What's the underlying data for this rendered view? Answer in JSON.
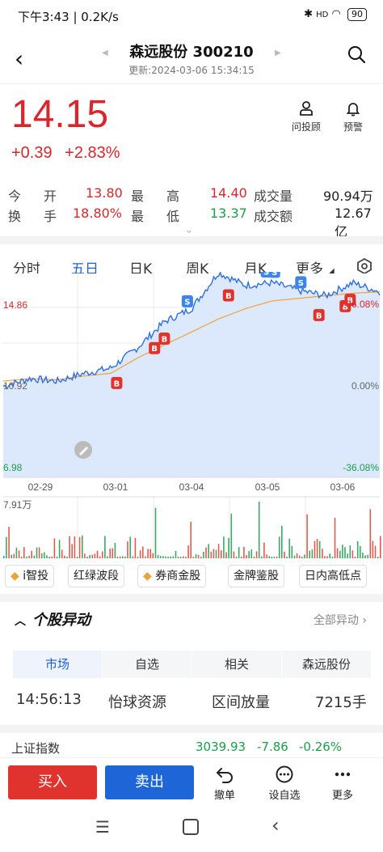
{
  "status_bar": {
    "time_info": "下午3:43 | 0.2K/s",
    "battery": "90",
    "signal": "HD"
  },
  "header": {
    "title": "森远股份 300210",
    "update_time": "更新:2024-03-06 15:34:15"
  },
  "quote": {
    "price": "14.15",
    "change": "+0.39",
    "change_pct": "+2.83%",
    "actions": [
      {
        "label": "问投顾",
        "icon": "advisor-icon"
      },
      {
        "label": "预警",
        "icon": "bell-icon"
      }
    ]
  },
  "stats": {
    "open_label": "今　开",
    "open": "13.80",
    "high_label": "最　高",
    "high": "14.40",
    "volume_label": "成交量",
    "volume": "90.94万",
    "turnover_label": "换　手",
    "turnover": "18.80%",
    "low_label": "最　低",
    "low": "13.37",
    "amount_label": "成交额",
    "amount": "12.67亿"
  },
  "tabs": [
    "分时",
    "五日",
    "日K",
    "周K",
    "月K",
    "更多"
  ],
  "active_tab": "五日",
  "chart_data": {
    "type": "line",
    "x": [
      "02-29",
      "03-01",
      "03-04",
      "03-05",
      "03-06"
    ],
    "y_left": {
      "top": "14.86",
      "mid": "10.92",
      "bottom": "6.98"
    },
    "y_right": {
      "top": "+36.08%",
      "mid": "0.00%",
      "bottom": "-36.08%"
    },
    "series": [
      {
        "values": [
          10.5,
          10.8,
          10.7,
          11.0,
          11.2,
          12.0,
          13.0,
          13.5,
          14.9,
          14.4,
          14.5,
          14.2,
          14.0,
          14.5,
          14.15
        ]
      },
      {
        "values": [
          10.7,
          10.8,
          10.75,
          10.9,
          11.0,
          11.6,
          12.1,
          12.6,
          13.1,
          13.5,
          13.8,
          13.9,
          14.0,
          14.1,
          14.15
        ]
      }
    ],
    "volume_max_label": "7.91万",
    "markers": [
      "B",
      "S"
    ]
  },
  "pills": [
    "i智投",
    "红绿波段",
    "券商金股",
    "金牌鉴股",
    "日内高低点"
  ],
  "abnormal": {
    "title": "个股异动",
    "all_label": "全部异动",
    "segments": [
      "市场",
      "自选",
      "相关",
      "森远股份"
    ],
    "row": {
      "time": "14:56:13",
      "name": "怡球资源",
      "event": "区间放量",
      "amount": "7215手"
    }
  },
  "index_bar": {
    "name": "上证指数",
    "value": "3039.93",
    "change": "-7.86",
    "pct": "-0.26%"
  },
  "bottom": {
    "buy": "买入",
    "sell": "卖出",
    "actions": [
      {
        "label": "撤单"
      },
      {
        "label": "设自选"
      },
      {
        "label": "更多"
      }
    ]
  },
  "colors": {
    "up": "#d9262c",
    "down": "#1a9e4b",
    "accent": "#1e5fd8"
  }
}
